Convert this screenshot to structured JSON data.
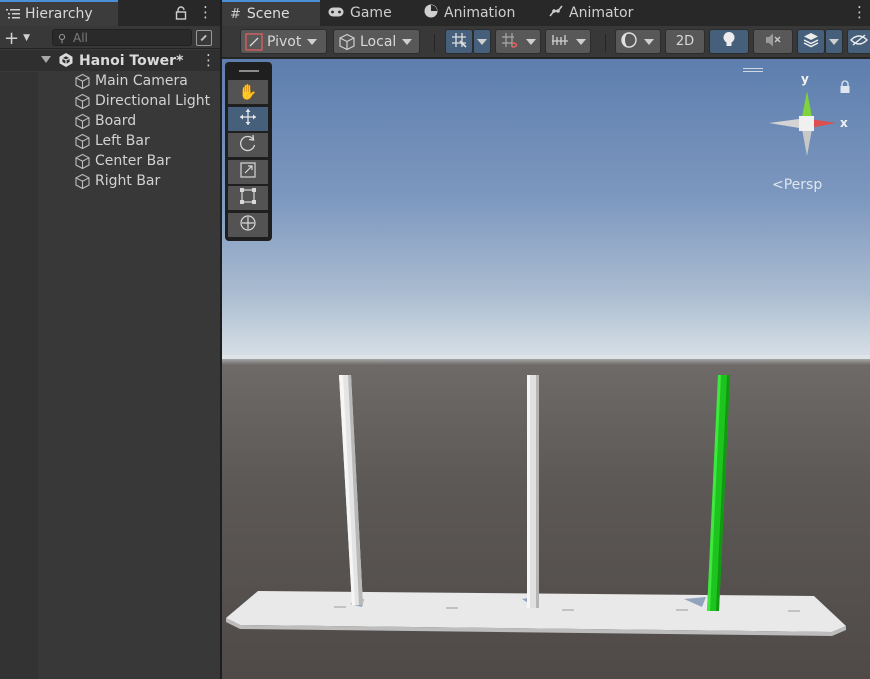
{
  "hierarchy": {
    "tab_label": "Hierarchy",
    "search_placeholder": "All",
    "scene_name": "Hanoi Tower*",
    "objects": [
      "Main Camera",
      "Directional Light",
      "Board",
      "Left Bar",
      "Center Bar",
      "Right Bar"
    ]
  },
  "scene_window": {
    "tabs": [
      {
        "label": "Scene",
        "icon": "grid-icon"
      },
      {
        "label": "Game",
        "icon": "gamepad-icon"
      },
      {
        "label": "Animation",
        "icon": "clock-icon"
      },
      {
        "label": "Animator",
        "icon": "animator-icon"
      }
    ],
    "active_tab": "Scene",
    "toolbar": {
      "pivot_label": "Pivot",
      "space_label": "Local",
      "twod_label": "2D"
    },
    "tools": [
      "hand-tool",
      "move-tool",
      "rotate-tool",
      "scale-tool",
      "rect-tool",
      "transform-tool"
    ],
    "active_tool": "move-tool",
    "gizmo": {
      "y_label": "y",
      "x_label": "x",
      "projection_label": "Persp"
    },
    "scene_objects": {
      "bars": [
        "white",
        "white",
        "green"
      ]
    }
  },
  "colors": {
    "accent": "#4c8fd6",
    "selected_tool": "#46607c",
    "green_bar": "#1ec41e",
    "white_bar": "#e6e6e6",
    "gizmo_x": "#e04d4d",
    "gizmo_y": "#7ed43a"
  }
}
